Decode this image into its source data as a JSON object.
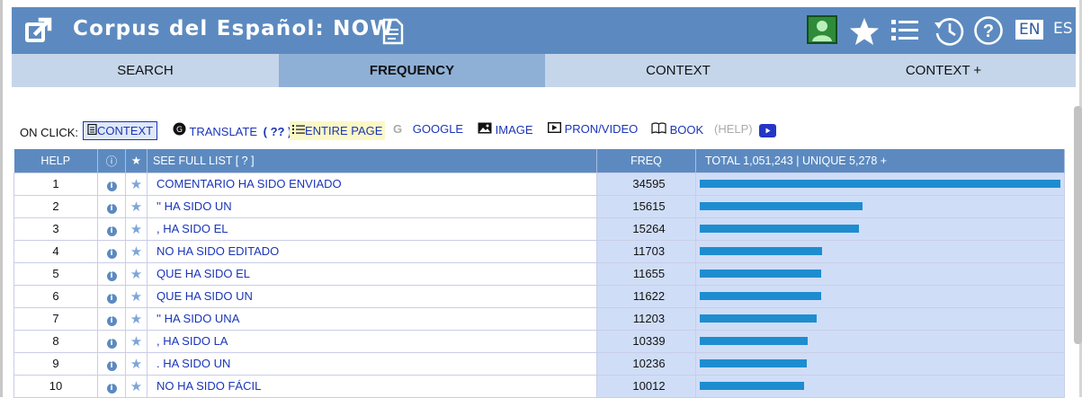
{
  "header": {
    "title": "Corpus del Español: NOW",
    "lang_en": "EN",
    "lang_es": "ES"
  },
  "tabs": [
    "SEARCH",
    "FREQUENCY",
    "CONTEXT",
    "CONTEXT +"
  ],
  "on_click": {
    "label": "ON CLICK:",
    "context": "CONTEXT",
    "translate": "TRANSLATE",
    "translate_q": "( ?? )",
    "entire_page": "ENTIRE PAGE",
    "google": "GOOGLE",
    "image": "IMAGE",
    "pron_video": "PRON/VIDEO",
    "book": "BOOK",
    "help": "(HELP)"
  },
  "table": {
    "col_help": "HELP",
    "col_info": "ⓘ",
    "col_star": "★",
    "col_full_list": "SEE FULL LIST  [ ? ]",
    "col_freq": "FREQ",
    "col_total": "TOTAL 1,051,243  |  UNIQUE 5,278  +",
    "rows": [
      {
        "n": "1",
        "term": "COMENTARIO HA SIDO ENVIADO",
        "freq": "34595",
        "value": 34595
      },
      {
        "n": "2",
        "term": "'' HA SIDO UN",
        "freq": "15615",
        "value": 15615
      },
      {
        "n": "3",
        "term": ", HA SIDO EL",
        "freq": "15264",
        "value": 15264
      },
      {
        "n": "4",
        "term": "NO HA SIDO EDITADO",
        "freq": "11703",
        "value": 11703
      },
      {
        "n": "5",
        "term": "QUE HA SIDO EL",
        "freq": "11655",
        "value": 11655
      },
      {
        "n": "6",
        "term": "QUE HA SIDO UN",
        "freq": "11622",
        "value": 11622
      },
      {
        "n": "7",
        "term": "'' HA SIDO UNA",
        "freq": "11203",
        "value": 11203
      },
      {
        "n": "8",
        "term": ", HA SIDO LA",
        "freq": "10339",
        "value": 10339
      },
      {
        "n": "9",
        "term": ". HA SIDO UN",
        "freq": "10236",
        "value": 10236
      },
      {
        "n": "10",
        "term": "NO HA SIDO FÁCIL",
        "freq": "10012",
        "value": 10012
      }
    ]
  },
  "colors": {
    "header_bg": "#5c8ac0",
    "tab_bg": "#c5d6ea",
    "tab_active_bg": "#8fb0d6",
    "bar": "#1e8dd0",
    "link": "#1a35b8"
  }
}
